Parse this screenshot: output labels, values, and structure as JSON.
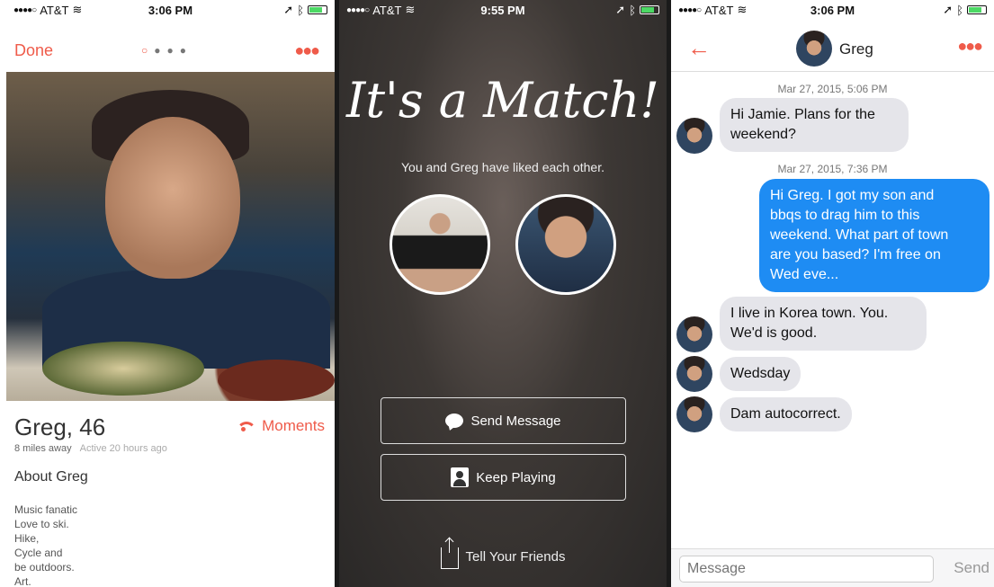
{
  "profile_screen": {
    "status": {
      "carrier": "AT&T",
      "time": "3:06 PM"
    },
    "done_label": "Done",
    "name": "Greg, 46",
    "moments_label": "Moments",
    "distance": "8 miles away",
    "active": "Active 20 hours ago",
    "about_title": "About Greg",
    "bio_lines": [
      "Music fanatic",
      "Love to ski.",
      "Hike,",
      "Cycle and",
      "be outdoors.",
      "Art."
    ]
  },
  "match_screen": {
    "status": {
      "carrier": "AT&T",
      "time": "9:55 PM"
    },
    "title": "It's a Match!",
    "subtitle": "You and Greg have liked each other.",
    "send_message_label": "Send Message",
    "keep_playing_label": "Keep Playing",
    "tell_friends_label": "Tell Your Friends"
  },
  "chat_screen": {
    "status": {
      "carrier": "AT&T",
      "time": "3:06 PM"
    },
    "contact_name": "Greg",
    "messages": [
      {
        "timestamp": "Mar 27, 2015, 5:06 PM"
      },
      {
        "from": "Greg",
        "lines": [
          "Hi Jamie. Plans for the",
          "weekend?"
        ]
      },
      {
        "timestamp": "Mar 27, 2015, 7:36 PM"
      },
      {
        "from": "me",
        "lines": [
          "Hi Greg. I got my son and",
          "bbqs to drag him to this",
          "weekend. What part of town",
          "are you based? I'm free on",
          "Wed eve..."
        ]
      },
      {
        "from": "Greg",
        "lines": [
          "I live in Korea town. You.",
          "We'd is good."
        ]
      },
      {
        "from": "Greg",
        "lines": [
          "Wedsday"
        ]
      },
      {
        "from": "Greg",
        "lines": [
          "Dam autocorrect."
        ]
      }
    ],
    "input_placeholder": "Message",
    "send_label": "Send"
  },
  "colors": {
    "accent": "#ef5b4a",
    "sent_bubble": "#1e8cf3",
    "received_bubble": "#e5e5ea"
  }
}
